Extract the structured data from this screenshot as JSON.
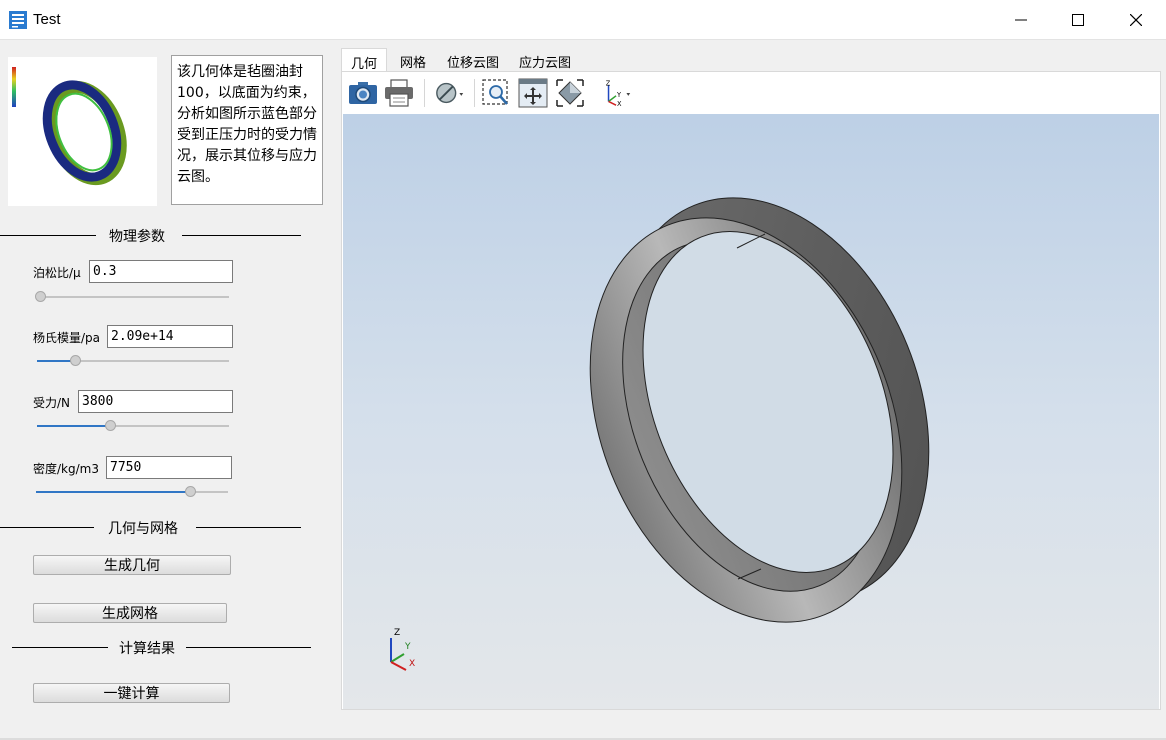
{
  "window": {
    "title": "Test"
  },
  "description": "该几何体是毡圈油封100，以底面为约束，分析如图所示蓝色部分受到正压力时的受力情况，展示其位移与应力云图。",
  "sections": {
    "physics": "物理参数",
    "geometry_mesh": "几何与网格",
    "results": "计算结果"
  },
  "params": {
    "poisson": {
      "label": "泊松比/μ",
      "value": "0.3",
      "slider_fraction": 0.0
    },
    "youngs": {
      "label": "杨氏模量/pa",
      "value": "2.09e+14",
      "slider_fraction": 0.2
    },
    "force": {
      "label": "受力/N",
      "value": "3800",
      "slider_fraction": 0.38
    },
    "density": {
      "label": "密度/kg/m3",
      "value": "7750",
      "slider_fraction": 0.8
    }
  },
  "buttons": {
    "gen_geometry": "生成几何",
    "gen_mesh": "生成网格",
    "compute": "一键计算"
  },
  "tabs": [
    "几何",
    "网格",
    "位移云图",
    "应力云图"
  ],
  "active_tab": 0,
  "axes": {
    "x": "X",
    "y": "Y",
    "z": "Z"
  },
  "colors": {
    "accent": "#3076c5",
    "ring": "#8a8a8a",
    "scene_top": "#bdd0e6",
    "scene_bottom": "#e4e7ea"
  },
  "icons": [
    "camera-icon",
    "printer-icon",
    "display-mode-icon",
    "zoom-box-icon",
    "pan-icon",
    "fit-all-icon",
    "axis-view-icon"
  ]
}
